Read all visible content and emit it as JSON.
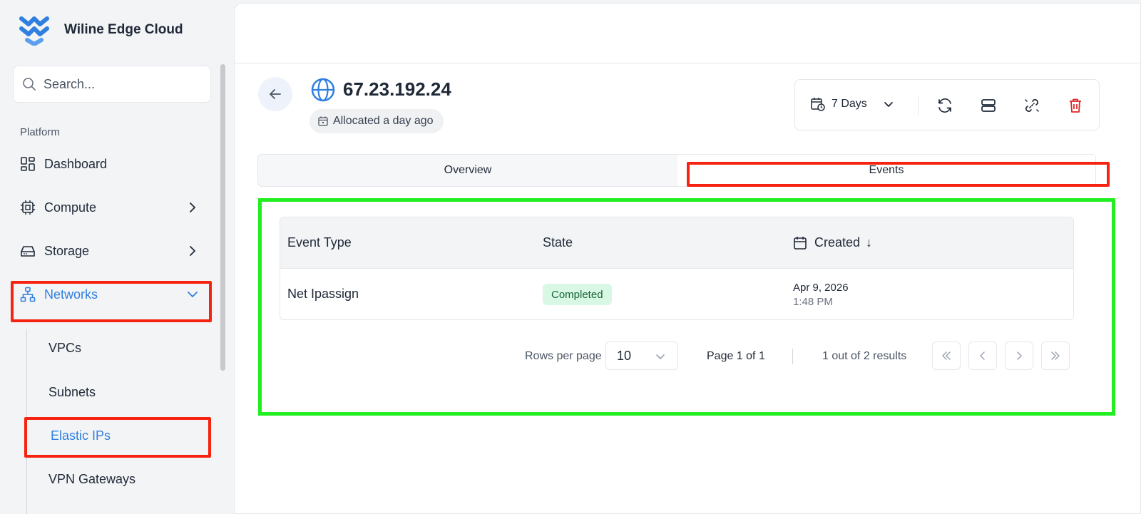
{
  "brand": {
    "name": "Wiline Edge Cloud"
  },
  "search": {
    "placeholder": "Search..."
  },
  "sidebar": {
    "section_label": "Platform",
    "items": [
      {
        "label": "Dashboard",
        "icon": "dashboard-icon"
      },
      {
        "label": "Compute",
        "icon": "cpu-icon"
      },
      {
        "label": "Storage",
        "icon": "hard-drive-icon"
      },
      {
        "label": "Networks",
        "icon": "network-icon",
        "active": true
      }
    ],
    "sub_items": [
      {
        "label": "VPCs"
      },
      {
        "label": "Subnets"
      },
      {
        "label": "Elastic IPs",
        "active": true
      },
      {
        "label": "VPN Gateways"
      }
    ]
  },
  "header": {
    "ip": "67.23.192.24",
    "allocated": "Allocated a day ago",
    "range_label": "7 Days"
  },
  "tabs": [
    {
      "label": "Overview"
    },
    {
      "label": "Events",
      "active": true
    }
  ],
  "table": {
    "columns": [
      "Event Type",
      "State",
      "Created"
    ],
    "sort_indicator": "↓",
    "rows": [
      {
        "event_type": "Net Ipassign",
        "state": "Completed",
        "date": "Apr 9, 2026",
        "time": "1:48 PM"
      }
    ]
  },
  "pagination": {
    "rows_per_page_label": "Rows per page",
    "rows_per_page": "10",
    "page_text": "Page 1 of 1",
    "results_text": "1 out of 2 results"
  },
  "colors": {
    "accent": "#2f7fe0",
    "danger": "#e02424",
    "success_bg": "#d9f7e5",
    "success_text": "#166534",
    "highlight_red": "#f5230f",
    "highlight_green": "#22ee22"
  }
}
